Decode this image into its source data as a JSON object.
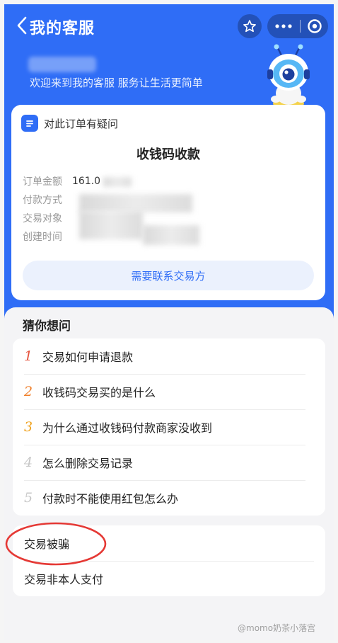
{
  "header": {
    "title": "我的客服",
    "greeting_sub": "欢迎来到我的客服 服务让生活更简单"
  },
  "order": {
    "question_label": "对此订单有疑问",
    "title": "收钱码收款",
    "rows": [
      {
        "label": "订单金额",
        "value": "161.0"
      },
      {
        "label": "付款方式",
        "value": ""
      },
      {
        "label": "交易对象",
        "value": ""
      },
      {
        "label": "创建时间",
        "value": ""
      }
    ],
    "contact_button": "需要联系交易方"
  },
  "guess": {
    "title": "猜你想问",
    "items": [
      {
        "num": "1",
        "text": "交易如何申请退款",
        "color": "#e5533d"
      },
      {
        "num": "2",
        "text": "收钱码交易买的是什么",
        "color": "#f07f2a"
      },
      {
        "num": "3",
        "text": "为什么通过收钱码付款商家没收到",
        "color": "#f0a320"
      },
      {
        "num": "4",
        "text": "怎么删除交易记录",
        "color": "#c7c7c7"
      },
      {
        "num": "5",
        "text": "付款时不能使用红包怎么办",
        "color": "#c7c7c7"
      }
    ]
  },
  "scam": {
    "items": [
      {
        "text": "交易被骗"
      },
      {
        "text": "交易非本人支付"
      }
    ]
  },
  "watermark": "@momo奶茶小落宫",
  "colors": {
    "primary_blue": "#2f6df6",
    "highlight_red": "#e53935"
  }
}
